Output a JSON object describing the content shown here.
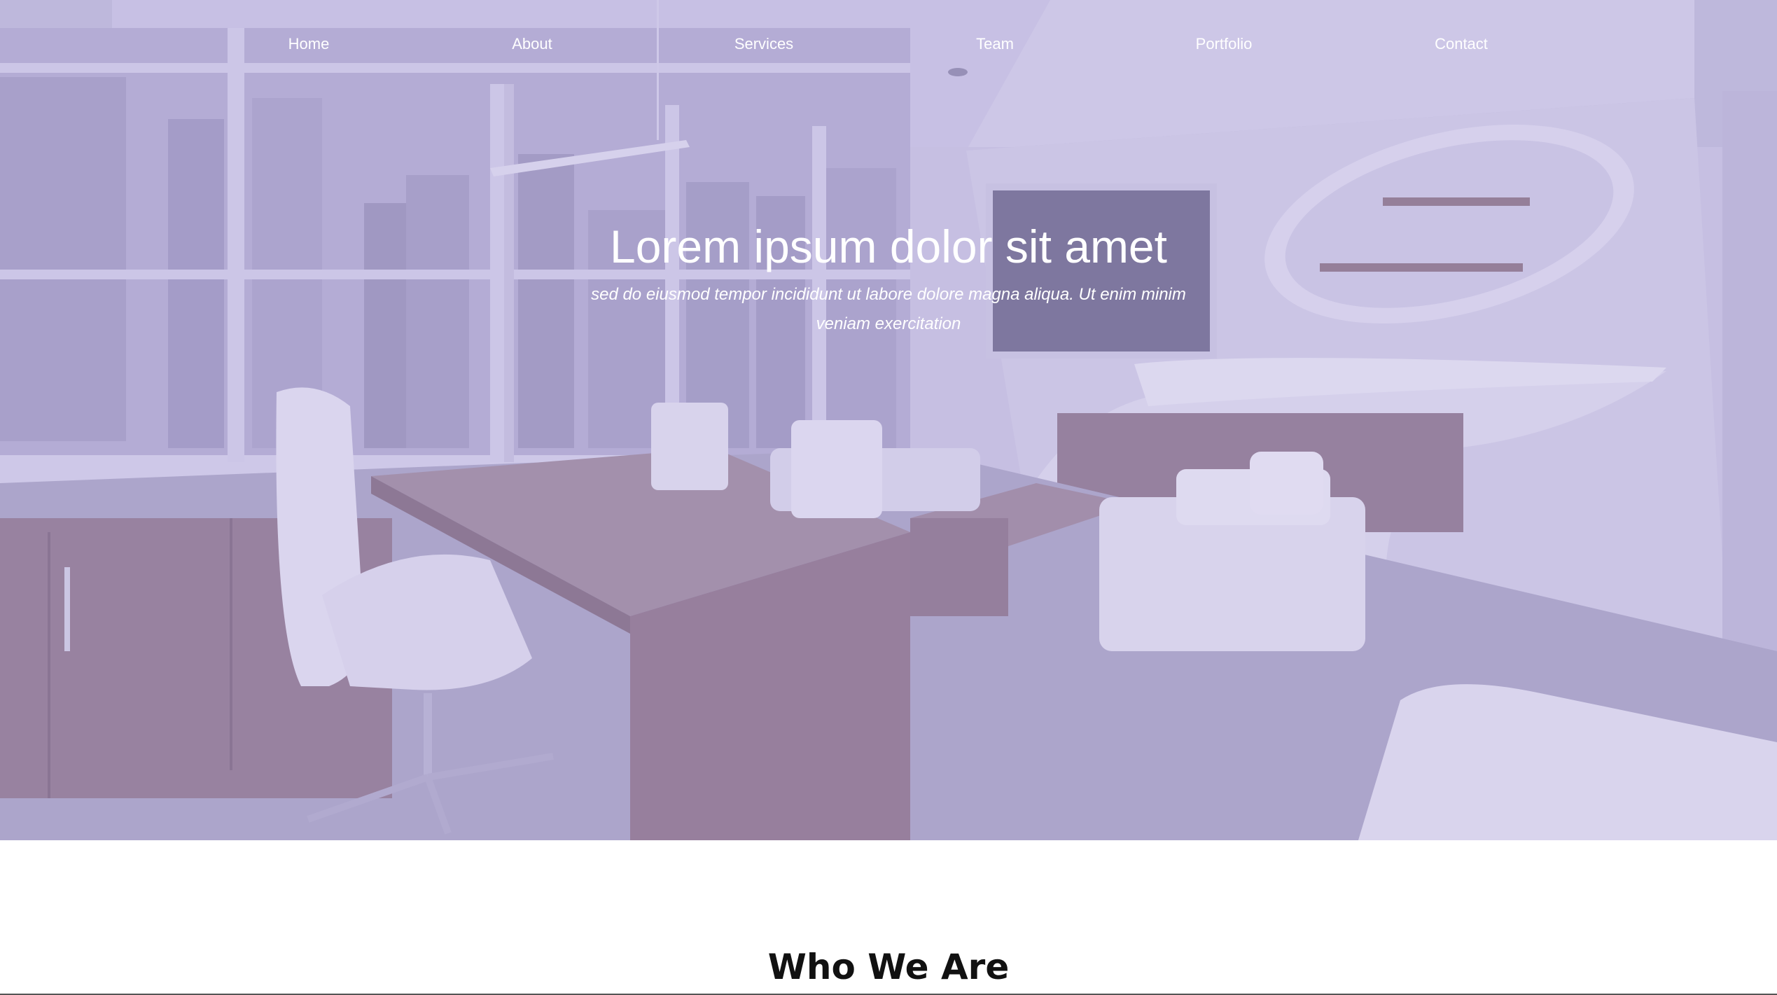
{
  "nav": {
    "items": [
      {
        "label": "Home"
      },
      {
        "label": "About"
      },
      {
        "label": "Services"
      },
      {
        "label": "Team"
      },
      {
        "label": "Portfolio"
      },
      {
        "label": "Contact"
      }
    ]
  },
  "hero": {
    "title": "Lorem ipsum dolor sit amet",
    "subtitle": "sed do eiusmod tempor incididunt ut labore dolore magna aliqua. Ut enim minim veniam exercitation",
    "overlay_color": "#b2a8de"
  },
  "about": {
    "heading": "Who We Are"
  },
  "colors": {
    "nav_text": "#ffffff",
    "heading_text": "#111111",
    "background": "#ffffff"
  }
}
